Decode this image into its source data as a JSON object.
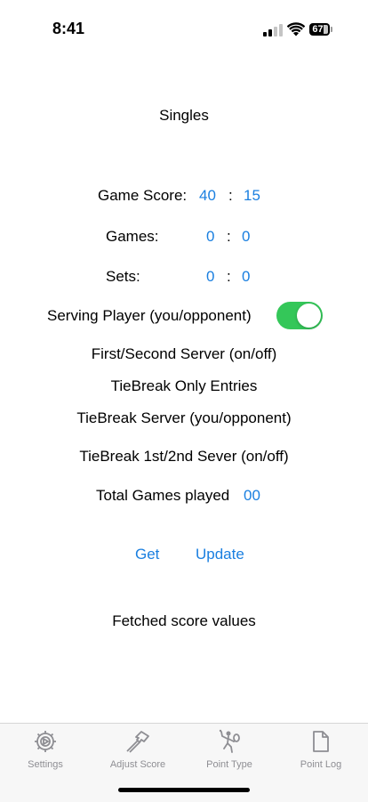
{
  "status_bar": {
    "time": "8:41",
    "battery": "67"
  },
  "title": "Singles",
  "game_score": {
    "label": "Game Score:",
    "you": "40",
    "separator": ":",
    "opponent": "15"
  },
  "games": {
    "label": "Games:",
    "you": "0",
    "separator": ":",
    "opponent": "0"
  },
  "sets": {
    "label": "Sets:",
    "you": "0",
    "separator": ":",
    "opponent": "0"
  },
  "serving_player": {
    "label": "Serving Player (you/opponent)",
    "toggle_on": true
  },
  "first_second_server_label": "First/Second Server (on/off)",
  "tiebreak_only_label": "TieBreak Only Entries",
  "tiebreak_server_label": "TieBreak Server (you/opponent)",
  "tiebreak_1st2nd_label": "TieBreak 1st/2nd Sever (on/off)",
  "total_games": {
    "label": "Total Games played",
    "value": "00"
  },
  "actions": {
    "get_label": "Get",
    "update_label": "Update"
  },
  "fetched_label": "Fetched score values",
  "tabs": [
    {
      "label": "Settings",
      "icon": "gear-icon"
    },
    {
      "label": "Adjust Score",
      "icon": "hammer-icon"
    },
    {
      "label": "Point Type",
      "icon": "tennis-player-icon"
    },
    {
      "label": "Point Log",
      "icon": "document-icon"
    }
  ],
  "colors": {
    "accent": "#1a7fe0",
    "toggle_on": "#34c759",
    "tab_inactive": "#8e8e93"
  }
}
